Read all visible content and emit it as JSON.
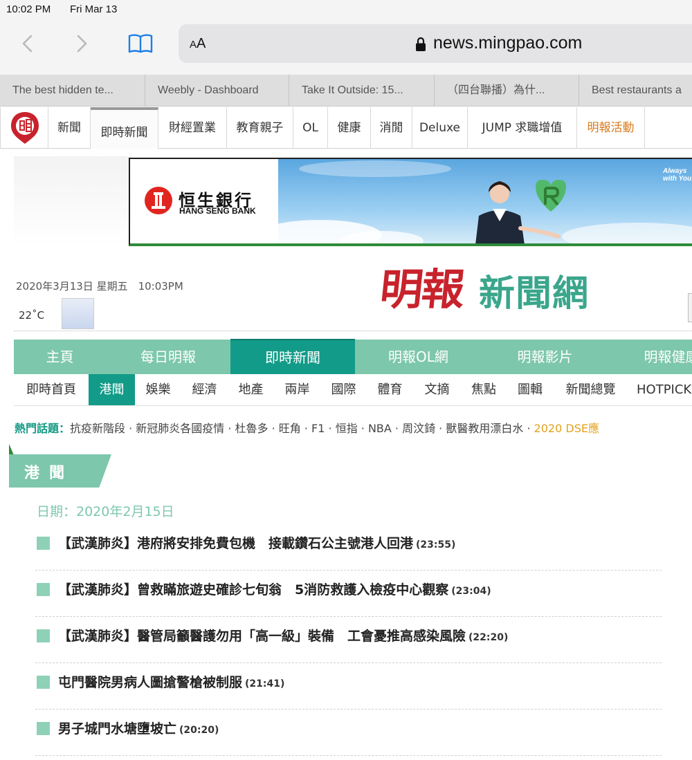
{
  "status_bar": {
    "time": "10:02 PM",
    "date": "Fri Mar 13"
  },
  "browser": {
    "text_size_button": "A",
    "text_size_button_small": "A",
    "url": "news.mingpao.com",
    "tabs": [
      "The best hidden te...",
      "Weebly - Dashboard",
      "Take It Outside: 15...",
      "（四台聯播）為什...",
      "Best restaurants a"
    ]
  },
  "site_nav": {
    "items": [
      "新聞",
      "即時新聞",
      "財經置業",
      "教育親子",
      "OL",
      "健康",
      "消閒",
      "Deluxe",
      "JUMP 求職增值",
      "明報活動"
    ],
    "active_index": 1
  },
  "banner": {
    "bank_name": "恒生銀行",
    "bank_name_en": "HANG SENG BANK",
    "slogan": "Always with You!"
  },
  "masthead": {
    "date": "2020年3月13日 星期五　10:03PM",
    "temperature": "22˚C",
    "brand_red": "明報",
    "brand_green": "新聞網"
  },
  "main_nav": {
    "items": [
      "主頁",
      "每日明報",
      "即時新聞",
      "明報OL網",
      "明報影片",
      "明報健康"
    ],
    "active_index": 2
  },
  "sub_nav": {
    "items": [
      "即時首頁",
      "港聞",
      "娛樂",
      "經濟",
      "地產",
      "兩岸",
      "國際",
      "體育",
      "文摘",
      "焦點",
      "圖輯",
      "新聞總覽",
      "HOTPICK"
    ],
    "active_index": 1
  },
  "hot_topics": {
    "label": "熱門話題：",
    "text": "抗疫新階段 · 新冠肺炎各國疫情 · 杜魯多 · 旺角 · F1 · 恒指 · NBA · 周汶錡 · 獸醫教用漂白水 · ",
    "highlight": "2020 DSE應"
  },
  "section": {
    "title": "港聞",
    "date_label": "日期：2020年2月15日"
  },
  "news": [
    {
      "headline": "【武漢肺炎】港府將安排免費包機　接載鑽石公主號港人回港",
      "time": "(23:55)"
    },
    {
      "headline": "【武漢肺炎】曾救瞞旅遊史確診七旬翁　5消防救護入檢疫中心觀察",
      "time": "(23:04)"
    },
    {
      "headline": "【武漢肺炎】醫管局籲醫護勿用「高一級」裝備　工會憂推高感染風險",
      "time": "(22:20)"
    },
    {
      "headline": "屯門醫院男病人圖搶警槍被制服",
      "time": "(21:41)"
    },
    {
      "headline": "男子城門水塘墮坡亡",
      "time": "(20:20)"
    }
  ],
  "colors": {
    "brand_green": "#7dc7ac",
    "active_teal": "#129b88",
    "brand_red": "#c8232c",
    "promo_orange": "#d97a1c",
    "dse_yellow": "#e2a21a"
  }
}
